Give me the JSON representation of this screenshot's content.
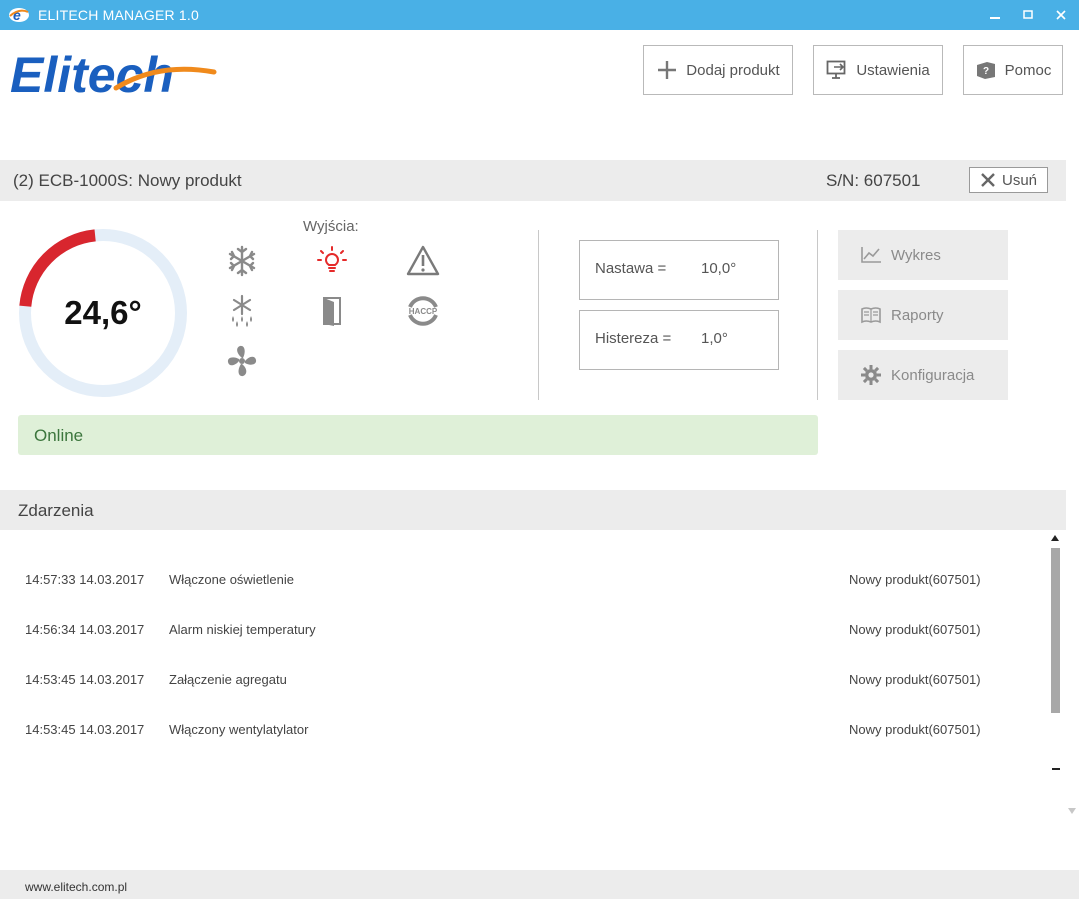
{
  "window": {
    "title": "ELITECH MANAGER 1.0",
    "controls": {
      "minimize": "–",
      "maximize": "□",
      "close": "✕"
    }
  },
  "brand": {
    "logo_text": "Elitech"
  },
  "toolbar": {
    "add_product": "Dodaj produkt",
    "settings": "Ustawienia",
    "help": "Pomoc"
  },
  "device": {
    "title": "(2) ECB-1000S: Nowy produkt",
    "serial": "S/N: 607501",
    "remove_label": "Usuń",
    "temperature": "24,6°",
    "gauge_fill_fraction": 0.22,
    "outputs_label": "Wyjścia:",
    "icons": [
      "snowflake-icon",
      "defrost-icon",
      "fan-icon",
      "light-icon",
      "door-icon",
      "alarm-icon",
      "haccp-icon"
    ],
    "light_active_color": "#e52a2a",
    "setpoint": {
      "label": "Nastawa =",
      "value": "10,0°"
    },
    "hysteresis": {
      "label": "Histereza =",
      "value": "1,0°"
    },
    "actions": {
      "chart": "Wykres",
      "reports": "Raporty",
      "config": "Konfiguracja"
    },
    "status": "Online"
  },
  "events": {
    "title": "Zdarzenia",
    "rows": [
      {
        "time": "14:57:33 14.03.2017",
        "description": "Włączone oświetlenie",
        "device": "Nowy produkt(607501)"
      },
      {
        "time": "14:56:34 14.03.2017",
        "description": "Alarm niskiej temperatury",
        "device": "Nowy produkt(607501)"
      },
      {
        "time": "14:53:45 14.03.2017",
        "description": "Załączenie agregatu",
        "device": "Nowy produkt(607501)"
      },
      {
        "time": "14:53:45 14.03.2017",
        "description": "Włączony wentylatylator",
        "device": "Nowy produkt(607501)"
      }
    ]
  },
  "footer": {
    "url": "www.elitech.com.pl"
  },
  "colors": {
    "titlebar": "#49b0e6",
    "gauge_track": "#e4eef8",
    "gauge_fill": "#d8262e",
    "status_bg": "#dff0d8",
    "status_text": "#3c763d",
    "icon_grey": "#8a8a8a",
    "brand_blue": "#1a5fbf",
    "brand_orange": "#f08a1c"
  }
}
